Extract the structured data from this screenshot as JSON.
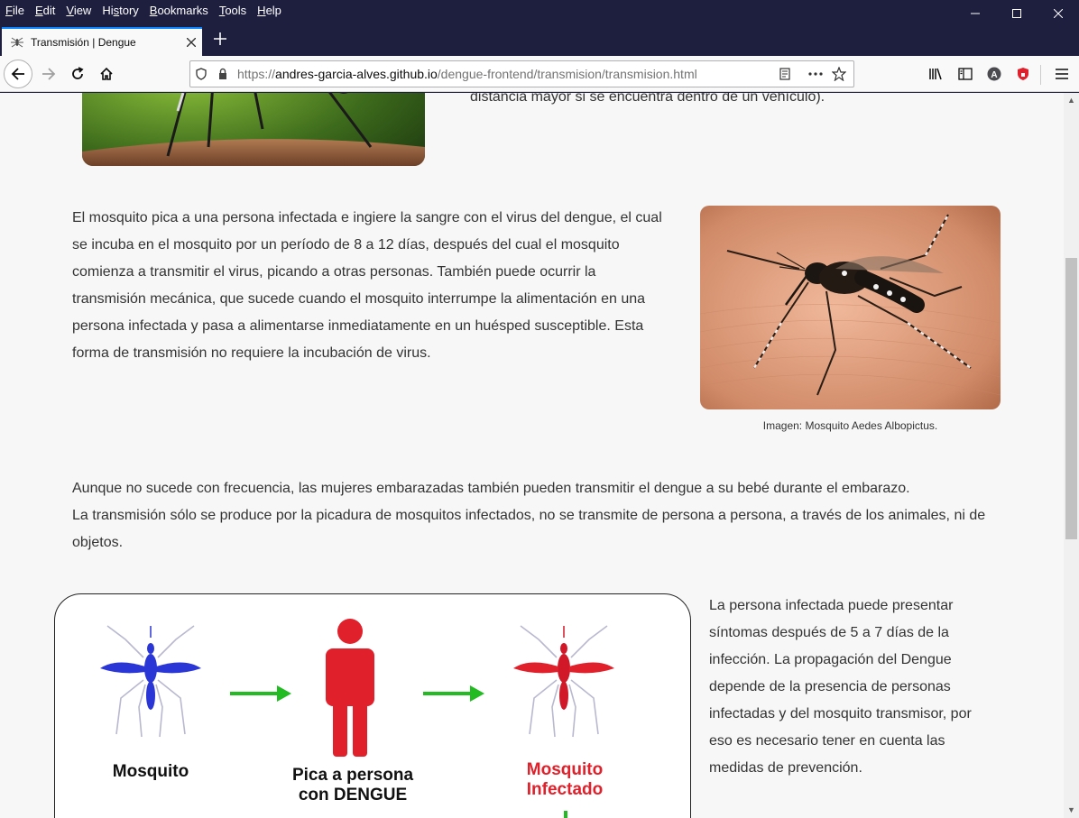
{
  "menu": {
    "items": [
      "File",
      "Edit",
      "View",
      "History",
      "Bookmarks",
      "Tools",
      "Help"
    ],
    "accel": [
      "F",
      "E",
      "V",
      "s",
      "B",
      "T",
      "H"
    ]
  },
  "tab": {
    "title": "Transmisión | Dengue"
  },
  "url": {
    "proto": "https://",
    "host": "andres-garcia-alves.github.io",
    "path": "/dengue-frontend/transmision/transmision.html"
  },
  "content": {
    "top_text": "distancia mayor si se encuentra dentro de un vehículo).",
    "para1": "El mosquito pica a una persona infectada e ingiere la sangre con el virus del dengue, el cual se incuba en el mosquito por un período de 8 a 12 días, después del cual el mosquito comienza a transmitir el virus, picando a otras personas. También puede ocurrir la transmisión mecánica, que sucede cuando el mosquito interrumpe la alimentación en una persona infectada y pasa a alimentarse inmediatamente en un huésped susceptible. Esta forma de transmisión no requiere la incubación de virus.",
    "caption": "Imagen: Mosquito Aedes Albopictus.",
    "para2_line1": "Aunque no sucede con frecuencia, las mujeres embarazadas también pueden transmitir el dengue a su bebé durante el embarazo.",
    "para2_line2": "La transmisión sólo se produce por la picadura de mosquitos infectados, no se transmite de persona a persona, a través de los animales, ni de objetos.",
    "para3": "La persona infectada puede presentar síntomas después de 5 a 7 días de la infección. La propagación del Dengue depende de la presencia de personas infectadas y del mosquito transmisor, por eso es necesario tener en cuenta las medidas de prevención.",
    "diagram": {
      "label1": "Mosquito",
      "label2_line1": "Pica a persona",
      "label2_line2": "con DENGUE",
      "label3_line1": "Mosquito",
      "label3_line2": "Infectado"
    }
  },
  "colors": {
    "chrome_dark": "#1e1f3f",
    "accent": "#0a84ff",
    "mosquito_blue": "#2b36d6",
    "infected_red": "#e0202a",
    "arrow_green": "#22bb22"
  }
}
